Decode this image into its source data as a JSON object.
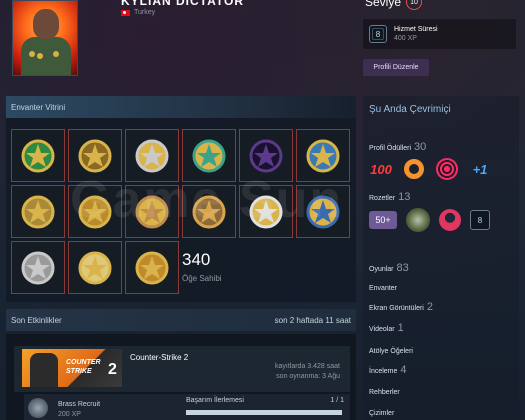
{
  "profile": {
    "name": "KYLIAN DICTATOR",
    "country": "Turkey"
  },
  "level": {
    "label": "Seviye",
    "value": "10"
  },
  "featured_badge": {
    "icon_text": "8",
    "title": "Hizmet Süresi",
    "xp": "400 XP"
  },
  "edit_profile_label": "Profili Düzenle",
  "showcase": {
    "title": "Envanter Vitrini",
    "items_count": "340",
    "items_label": "Öğe Sahibi",
    "medals": [
      "medal-green-star",
      "medal-gold-eagle",
      "medal-silver-star",
      "medal-teal-coin",
      "medal-purple-bird",
      "medal-blue-star",
      "medal-gold-wreath",
      "medal-gold-dragon",
      "medal-bronze-shield",
      "medal-five-coin",
      "medal-white-star",
      "medal-blue-gold-coin",
      "medal-silver-wreath",
      "medal-gold-burst",
      "medal-gold-starburst"
    ]
  },
  "activity": {
    "title": "Son Etkinlikler",
    "summary": "son 2 haftada 11 saat",
    "game": {
      "name": "Counter-Strike 2",
      "logo_line1": "COUNTER",
      "logo_line2": "STRIKE",
      "logo_num": "2",
      "hours": "kayıtlarda 3.428 saat",
      "last_played": "son oynanma: 3 Ağu"
    },
    "achievement": {
      "name": "Brass Recruit",
      "xp": "200 XP",
      "label": "Başarım İlerlemesi",
      "count": "1 / 1",
      "progress": 1.0
    }
  },
  "sidebar": {
    "online_status": "Şu Anda Çevrimiçi",
    "awards_label": "Profil Ödülleri",
    "awards_count": "30",
    "badges_label": "Rozetler",
    "badges_count": "13",
    "badge_50": "50+",
    "badge_8": "8",
    "games_label": "Oyunlar",
    "games_count": "83",
    "inventory_label": "Envanter",
    "screenshots_label": "Ekran Görüntüleri",
    "screenshots_count": "2",
    "videos_label": "Videolar",
    "videos_count": "1",
    "workshop_label": "Atölye Öğeleri",
    "reviews_label": "İnceleme",
    "reviews_count": "4",
    "guides_label": "Rehberler",
    "artwork_label": "Çizimler"
  },
  "colors": {
    "background": "#1b2838",
    "accent_red": "#e74c4c",
    "online_blue": "#9ac0e0",
    "edit_button": "#3d2f52"
  }
}
